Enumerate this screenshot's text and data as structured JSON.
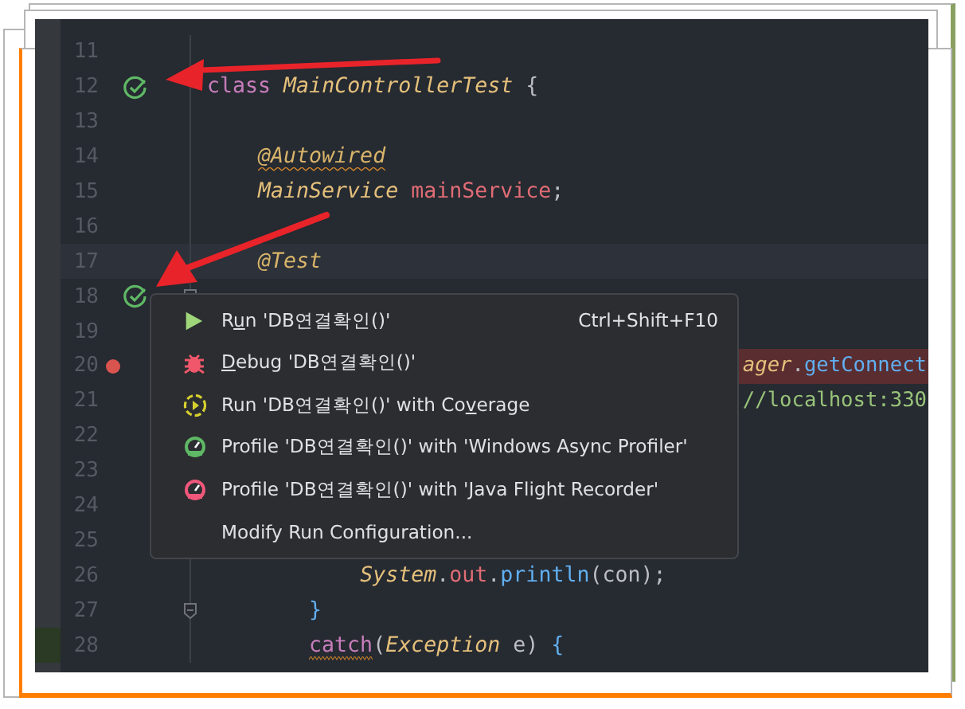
{
  "editor": {
    "lines": [
      {
        "number": "11"
      },
      {
        "number": "12",
        "run_icon": true,
        "tokens": [
          {
            "kind": "keyword",
            "text": "class "
          },
          {
            "kind": "type",
            "text": "MainControllerTest"
          },
          {
            "kind": "plain",
            "text": " {"
          }
        ],
        "children": [
          {
            "number": "13"
          },
          {
            "number": "14",
            "tokens": [
              {
                "kind": "annotation",
                "text": "@Autowired",
                "warning": true
              }
            ]
          },
          {
            "number": "15",
            "tokens": [
              {
                "kind": "type",
                "text": "MainService "
              },
              {
                "kind": "field",
                "text": "mainService"
              },
              {
                "kind": "plain",
                "text": ";"
              }
            ]
          },
          {
            "number": "16"
          },
          {
            "number": "17",
            "current": true,
            "tokens": [
              {
                "kind": "annotation",
                "text": "@Test"
              }
            ]
          },
          {
            "number": "18",
            "fold": true,
            "run_icon": true,
            "children": [
              {
                "number": "19"
              },
              {
                "number": "20",
                "breakpoint": true,
                "tail": [
                  {
                    "kind": "type",
                    "text": "ager"
                  },
                  {
                    "kind": "plain",
                    "text": "."
                  },
                  {
                    "kind": "method",
                    "text": "getConnect"
                  }
                ]
              },
              {
                "number": "21",
                "tail": [
                  {
                    "kind": "string",
                    "text": "//localhost:330"
                  }
                ]
              },
              {
                "number": "22"
              },
              {
                "number": "23"
              },
              {
                "number": "24"
              },
              {
                "number": "25",
                "children": [
                  {
                    "number": "26",
                    "tokens": [
                      {
                        "kind": "type",
                        "text": "System"
                      },
                      {
                        "kind": "plain",
                        "text": "."
                      },
                      {
                        "kind": "field",
                        "text": "out"
                      },
                      {
                        "kind": "plain",
                        "text": "."
                      },
                      {
                        "kind": "method",
                        "text": "println"
                      },
                      {
                        "kind": "plain",
                        "text": "(con);"
                      }
                    ]
                  }
                ]
              },
              {
                "number": "27",
                "fold": true,
                "tokens": [
                  {
                    "kind": "method",
                    "text": "}"
                  }
                ]
              },
              {
                "number": "28",
                "changed": true,
                "tokens": [
                  {
                    "kind": "keyword",
                    "text": "catch",
                    "warning": true
                  },
                  {
                    "kind": "plain",
                    "text": "("
                  },
                  {
                    "kind": "type",
                    "text": "Exception "
                  },
                  {
                    "kind": "plain",
                    "text": "e) "
                  },
                  {
                    "kind": "method",
                    "text": "{"
                  }
                ]
              }
            ]
          }
        ]
      }
    ]
  },
  "context_menu": {
    "items": [
      {
        "kind": "run",
        "before": "R",
        "key": "u",
        "after": "n 'DB연결확인()'",
        "shortcut": "Ctrl+Shift+F10"
      },
      {
        "kind": "debug",
        "key": "D",
        "after": "ebug 'DB연결확인()'"
      },
      {
        "kind": "coverage",
        "before": "Run 'DB연결확인()' with Co",
        "key": "v",
        "after": "erage"
      },
      {
        "kind": "profile",
        "before": "Profile 'DB연결확인()' with 'Windows Async Profiler'",
        "color": "#5fb865"
      },
      {
        "kind": "profile",
        "before": "Profile 'DB연결확인()' with 'Java Flight Recorder'",
        "color": "#f0577a"
      },
      {
        "kind": "plain",
        "before": "Modify Run Configuration..."
      }
    ]
  }
}
